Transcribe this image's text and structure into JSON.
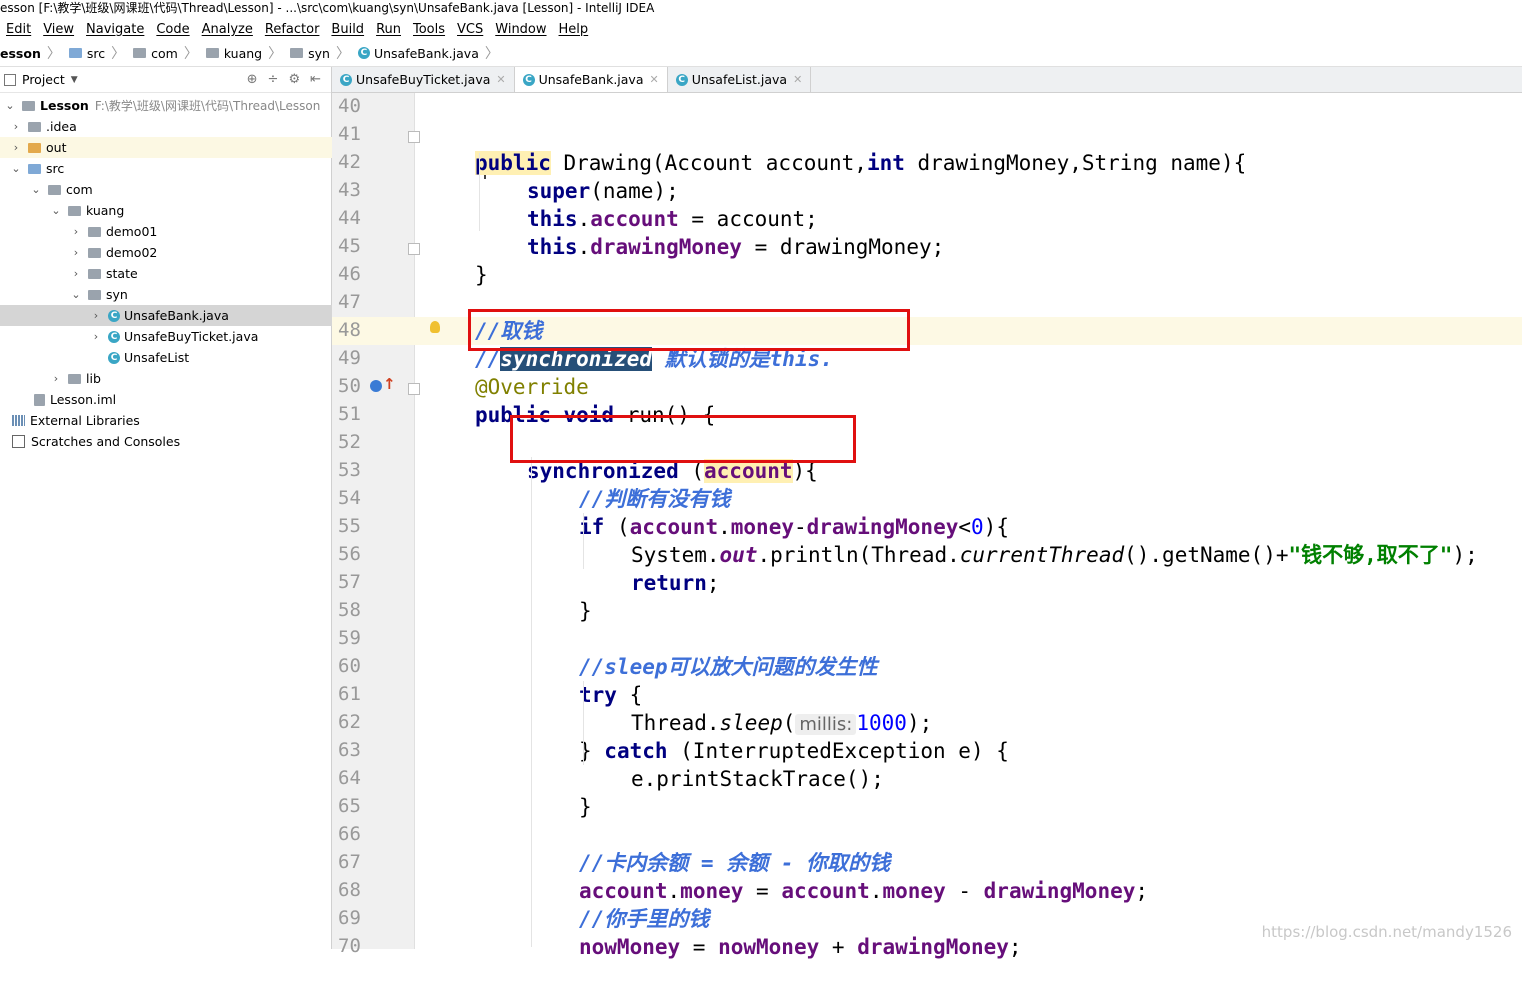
{
  "window": {
    "title": "esson [F:\\教学\\班级\\网课班\\代码\\Thread\\Lesson] - ...\\src\\com\\kuang\\syn\\UnsafeBank.java [Lesson] - IntelliJ IDEA"
  },
  "menu": [
    "Edit",
    "View",
    "Navigate",
    "Code",
    "Analyze",
    "Refactor",
    "Build",
    "Run",
    "Tools",
    "VCS",
    "Window",
    "Help"
  ],
  "breadcrumb": [
    "esson",
    "src",
    "com",
    "kuang",
    "syn",
    "UnsafeBank.java"
  ],
  "project": {
    "header": "Project",
    "tree": [
      {
        "label": "Lesson",
        "path": "F:\\教学\\班级\\网课班\\代码\\Thread\\Lesson"
      },
      {
        "label": ".idea"
      },
      {
        "label": "out"
      },
      {
        "label": "src"
      },
      {
        "label": "com"
      },
      {
        "label": "kuang"
      },
      {
        "label": "demo01"
      },
      {
        "label": "demo02"
      },
      {
        "label": "state"
      },
      {
        "label": "syn"
      },
      {
        "label": "UnsafeBank.java"
      },
      {
        "label": "UnsafeBuyTicket.java"
      },
      {
        "label": "UnsafeList"
      },
      {
        "label": "lib"
      },
      {
        "label": "Lesson.iml"
      },
      {
        "label": "External Libraries"
      },
      {
        "label": "Scratches and Consoles"
      }
    ]
  },
  "tabs": [
    "UnsafeBuyTicket.java",
    "UnsafeBank.java",
    "UnsafeList.java"
  ],
  "line_numbers": [
    "40",
    "41",
    "42",
    "43",
    "44",
    "45",
    "46",
    "47",
    "48",
    "49",
    "50",
    "51",
    "52",
    "53",
    "54",
    "55",
    "56",
    "57",
    "58",
    "59",
    "60",
    "61",
    "62",
    "63",
    "64",
    "65",
    "66",
    "67",
    "68",
    "69",
    "70"
  ],
  "code": {
    "l41_public": "public",
    "l41_a": " Drawing(Account account,",
    "l41_int": "int",
    "l41_b": " drawingMoney,String name){",
    "l42_super": "super",
    "l42_rest": "(name);",
    "l43_this": "this",
    "l43_dot": ".",
    "l43_field": "account",
    "l43_rest": " = account;",
    "l44_this": "this",
    "l44_dot": ".",
    "l44_field": "drawingMoney",
    "l44_rest": " = drawingMoney;",
    "l45": "}",
    "l47": "//取钱",
    "l48_slash": "//",
    "l48_sel": "synchronized",
    "l48_rest": " 默认锁的是this.",
    "l49": "@Override",
    "l50_kw": "public void",
    "l50_rest": " run() {",
    "l52_kw": "synchronized",
    "l52_a": " (",
    "l52_acc": "account",
    "l52_b": "){",
    "l53": "//判断有没有钱",
    "l54_if": "if",
    "l54_a": " (",
    "l54_f1": "account",
    "l54_dot": ".",
    "l54_f2": "money",
    "l54_minus": "-",
    "l54_f3": "drawingMoney",
    "l54_lt": "<",
    "l54_zero": "0",
    "l54_end": "){",
    "l55_a": "System.",
    "l55_out": "out",
    "l55_b": ".println(Thread.",
    "l55_ct": "currentThread",
    "l55_c": "().getName()+",
    "l55_str": "\"钱不够,取不了\"",
    "l55_d": ");",
    "l56_ret": "return",
    "l56_semi": ";",
    "l57": "}",
    "l59": "//sleep可以放大问题的发生性",
    "l60_try": "try",
    "l60_rest": " {",
    "l61_a": "Thread.",
    "l61_sleep": "sleep",
    "l61_b": "(",
    "l61_hint": "millis:",
    "l61_num": "1000",
    "l61_c": ");",
    "l62_a": "} ",
    "l62_catch": "catch",
    "l62_b": " (InterruptedException e) {",
    "l63": "e.printStackTrace();",
    "l64": "}",
    "l66": "//卡内余额 = 余额 - 你取的钱",
    "l67_f1": "account",
    "l67_d1": ".",
    "l67_f2": "money",
    "l67_eq": " = ",
    "l67_f3": "account",
    "l67_d2": ".",
    "l67_f4": "money",
    "l67_minus": " - ",
    "l67_f5": "drawingMoney",
    "l67_semi": ";",
    "l68": "//你手里的钱",
    "l69_f1": "nowMoney",
    "l69_eq": " = ",
    "l69_f2": "nowMoney",
    "l69_plus": " + ",
    "l69_f3": "drawingMoney",
    "l69_semi": ";"
  },
  "watermark": "https://blog.csdn.net/mandy1526"
}
